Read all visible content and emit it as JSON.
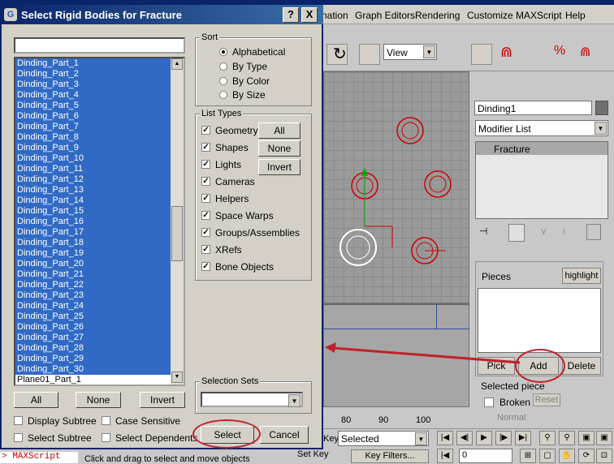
{
  "app": {
    "menu": [
      "nation",
      "Graph Editors",
      "Rendering",
      "Customize",
      "MAXScript",
      "Help"
    ],
    "view_dropdown": "View",
    "object_name": "Dinding1",
    "modifier_list": "Modifier List",
    "stack_item": "Fracture",
    "pieces_label": "Pieces",
    "highlight_label": "highlight",
    "pick_label": "Pick",
    "add_label": "Add",
    "delete_label": "Delete",
    "selected_piece_label": "Selected piece",
    "broken_label": "Broken",
    "reset_label": "Reset",
    "normal_label": "Normal",
    "ruler": [
      "80",
      "90",
      "100"
    ],
    "key_label": "Key",
    "selected_dropdown": "Selected",
    "set_key": "Set Key",
    "key_filters": "Key Filters...",
    "frame_value": "0",
    "maxscript": "> MAXScript",
    "status_text": "Click and drag to select and move objects"
  },
  "dialog": {
    "title": "Select Rigid Bodies for Fracture",
    "help_btn": "?",
    "close_btn": "X",
    "search_value": "",
    "list_items": [
      "Dinding_Part_1",
      "Dinding_Part_2",
      "Dinding_Part_3",
      "Dinding_Part_4",
      "Dinding_Part_5",
      "Dinding_Part_6",
      "Dinding_Part_7",
      "Dinding_Part_8",
      "Dinding_Part_9",
      "Dinding_Part_10",
      "Dinding_Part_11",
      "Dinding_Part_12",
      "Dinding_Part_13",
      "Dinding_Part_14",
      "Dinding_Part_15",
      "Dinding_Part_16",
      "Dinding_Part_17",
      "Dinding_Part_18",
      "Dinding_Part_19",
      "Dinding_Part_20",
      "Dinding_Part_21",
      "Dinding_Part_22",
      "Dinding_Part_23",
      "Dinding_Part_24",
      "Dinding_Part_25",
      "Dinding_Part_26",
      "Dinding_Part_27",
      "Dinding_Part_28",
      "Dinding_Part_29",
      "Dinding_Part_30",
      "Plane01_Part_1"
    ],
    "sort": {
      "label": "Sort",
      "options": [
        "Alphabetical",
        "By Type",
        "By Color",
        "By Size"
      ]
    },
    "list_types": {
      "label": "List Types",
      "items": [
        "Geometry",
        "Shapes",
        "Lights",
        "Cameras",
        "Helpers",
        "Space Warps",
        "Groups/Assemblies",
        "XRefs",
        "Bone Objects"
      ],
      "all": "All",
      "none": "None",
      "invert": "Invert"
    },
    "selection_sets": "Selection Sets",
    "bottom_all": "All",
    "bottom_none": "None",
    "bottom_invert": "Invert",
    "display_subtree": "Display Subtree",
    "case_sensitive": "Case Sensitive",
    "select_subtree": "Select Subtree",
    "select_dependents": "Select Dependents",
    "select_btn": "Select",
    "cancel_btn": "Cancel"
  },
  "colors": {
    "title": "#0a246a",
    "selection": "#316ac5",
    "annotation": "#c0222a"
  }
}
